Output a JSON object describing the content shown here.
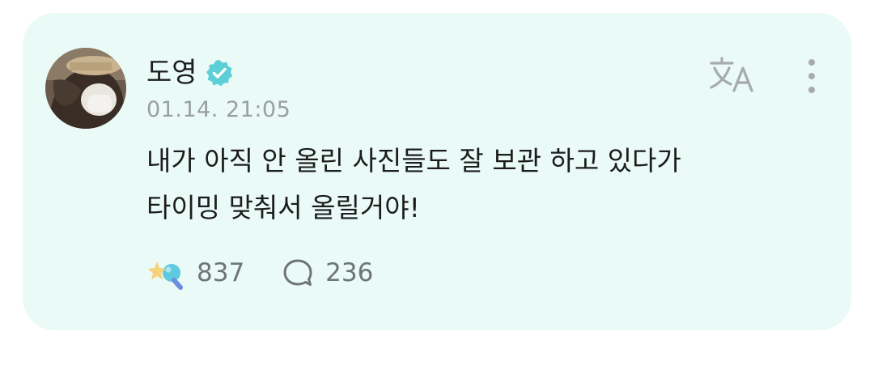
{
  "post": {
    "author": {
      "name": "도영",
      "verified": true
    },
    "timestamp": "01.14. 21:05",
    "body_lines": [
      "내가 아직 안 올린 사진들도 잘 보관 하고 있다가",
      "타이밍 맞춰서 올릴거야!"
    ],
    "reactions": {
      "like_count": "837",
      "comment_count": "236"
    }
  },
  "icons": {
    "verified": "verified-badge-icon",
    "translate": "translate-icon",
    "more": "more-vertical-icon",
    "like": "star-wand-icon",
    "comment": "comment-bubble-icon"
  },
  "colors": {
    "card_background": "#eafaf7",
    "verified_badge": "#5cd0d6",
    "text_primary": "#1c1c1c",
    "text_secondary": "#9a9ea3",
    "icon_gray": "#a6abae"
  }
}
